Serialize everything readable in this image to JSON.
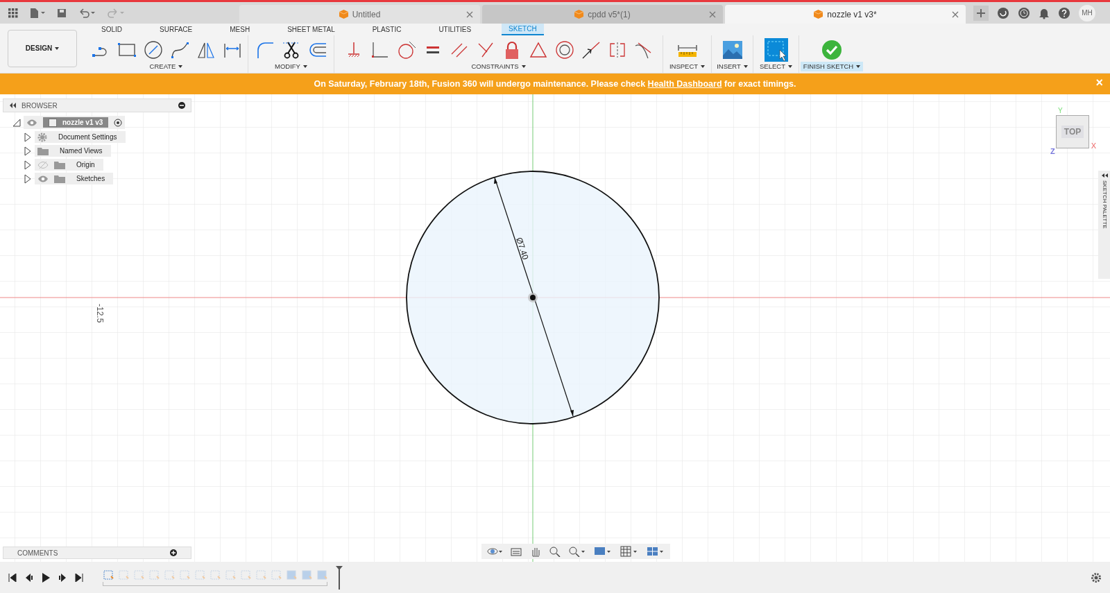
{
  "doc_tabs": [
    {
      "label": "Untitled",
      "selected": false
    },
    {
      "label": "cpdd v5*(1)",
      "selected": false
    },
    {
      "label": "nozzle v1 v3*",
      "selected": true
    }
  ],
  "user": {
    "initials": "MH"
  },
  "workspace": {
    "label": "DESIGN"
  },
  "toolbar_tabs": [
    {
      "label": "SOLID",
      "selected": false
    },
    {
      "label": "SURFACE",
      "selected": false
    },
    {
      "label": "MESH",
      "selected": false
    },
    {
      "label": "SHEET METAL",
      "selected": false
    },
    {
      "label": "PLASTIC",
      "selected": false
    },
    {
      "label": "UTILITIES",
      "selected": false
    },
    {
      "label": "SKETCH",
      "selected": true
    }
  ],
  "tool_groups": [
    {
      "kind": "create",
      "label": "CREATE",
      "active": false
    },
    {
      "kind": "modify",
      "label": "MODIFY",
      "active": false
    },
    {
      "kind": "constraints",
      "label": "CONSTRAINTS",
      "active": false
    },
    {
      "kind": "inspect",
      "label": "INSPECT",
      "active": false
    },
    {
      "kind": "insert",
      "label": "INSERT",
      "active": false
    },
    {
      "kind": "select",
      "label": "SELECT",
      "active": false
    },
    {
      "kind": "finish",
      "label": "FINISH SKETCH",
      "active": true
    }
  ],
  "banner": {
    "text_before": "On Saturday, February 18th, Fusion 360 will undergo maintenance. Please check ",
    "link": "Health Dashboard",
    "text_after": " for exact timings.",
    "close": "×"
  },
  "browser": {
    "title": "BROWSER",
    "root": {
      "label": "nozzle v1 v3",
      "expanded": true,
      "children": [
        {
          "label": "Document Settings",
          "kind": "settings"
        },
        {
          "label": "Named Views",
          "kind": "folder"
        },
        {
          "label": "Origin",
          "kind": "toggle_folder",
          "visible": false
        },
        {
          "label": "Sketches",
          "kind": "toggle_folder",
          "visible": true
        }
      ]
    }
  },
  "canvas": {
    "axis_reading": "-12.5",
    "dimension": "Ø7.40",
    "view_cube": "TOP",
    "axis_x": "X",
    "axis_y": "Y",
    "axis_z": "Z"
  },
  "sketch_palette": {
    "title": "SKETCH PALETTE"
  },
  "comments": {
    "title": "COMMENTS"
  }
}
